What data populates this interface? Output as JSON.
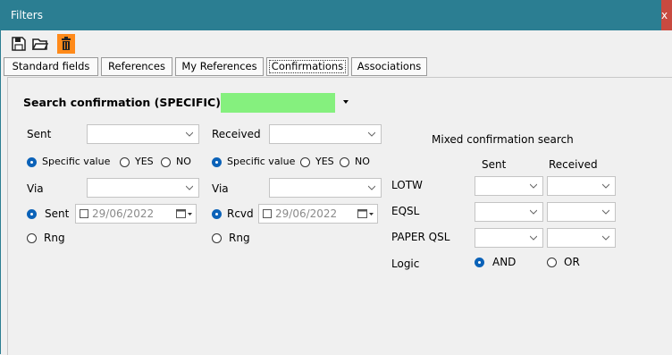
{
  "window": {
    "title": "Filters",
    "close_glyph": "x"
  },
  "toolbar": {
    "icons": [
      "save-icon",
      "open-folder-icon",
      "delete-icon"
    ]
  },
  "tabs": [
    "Standard fields",
    "References",
    "My References",
    "Confirmations",
    "Associations"
  ],
  "active_tab": "Confirmations",
  "search": {
    "label": "Search confirmation (SPECIFIC)",
    "value": ""
  },
  "sent": {
    "label": "Sent",
    "value": "",
    "specific_value": "Specific value",
    "yes": "YES",
    "no": "NO",
    "via_label": "Via",
    "via_value": "",
    "date_mode_label": "Sent",
    "date": "29/06/2022",
    "range_label": "Rng"
  },
  "received": {
    "label": "Received",
    "value": "",
    "specific_value": "Specific value",
    "yes": "YES",
    "no": "NO",
    "via_label": "Via",
    "via_value": "",
    "date_mode_label": "Rcvd",
    "date": "29/06/2022",
    "range_label": "Rng"
  },
  "mixed": {
    "title": "Mixed confirmation search",
    "col_sent": "Sent",
    "col_received": "Received",
    "rows": [
      "LOTW",
      "EQSL",
      "PAPER QSL"
    ],
    "logic_label": "Logic",
    "and_label": "AND",
    "or_label": "OR"
  },
  "colors": {
    "titlebar": "#2b7e92",
    "search_value_bg": "#85f07e",
    "radio_selected": "#0b62b8",
    "active_tool": "#ff8a1a"
  }
}
